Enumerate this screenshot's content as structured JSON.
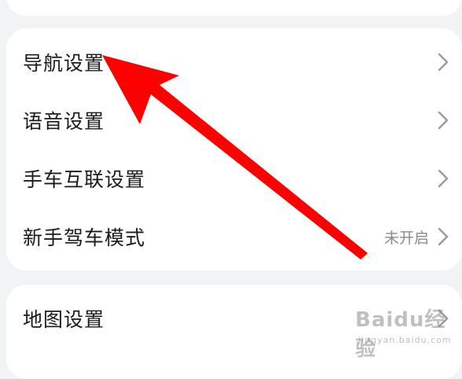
{
  "settings": {
    "group_main": [
      {
        "label": "导航设置",
        "status": ""
      },
      {
        "label": "语音设置",
        "status": ""
      },
      {
        "label": "手车互联设置",
        "status": ""
      },
      {
        "label": "新手驾车模式",
        "status": "未开启"
      }
    ],
    "group_bottom": [
      {
        "label": "地图设置",
        "status": ""
      }
    ]
  },
  "icons": {
    "chevron": "chevron-right-icon",
    "annotation": "red-pointer-arrow"
  },
  "colors": {
    "background": "#f2f3f5",
    "card": "#ffffff",
    "text": "#1b1b1b",
    "status_text": "#8a8a8a",
    "chevron": "#9a9a9a",
    "annotation_arrow": "#ff0000"
  },
  "watermark": {
    "main": "Baidu经验",
    "sub": "jingyan.baidu.com"
  }
}
